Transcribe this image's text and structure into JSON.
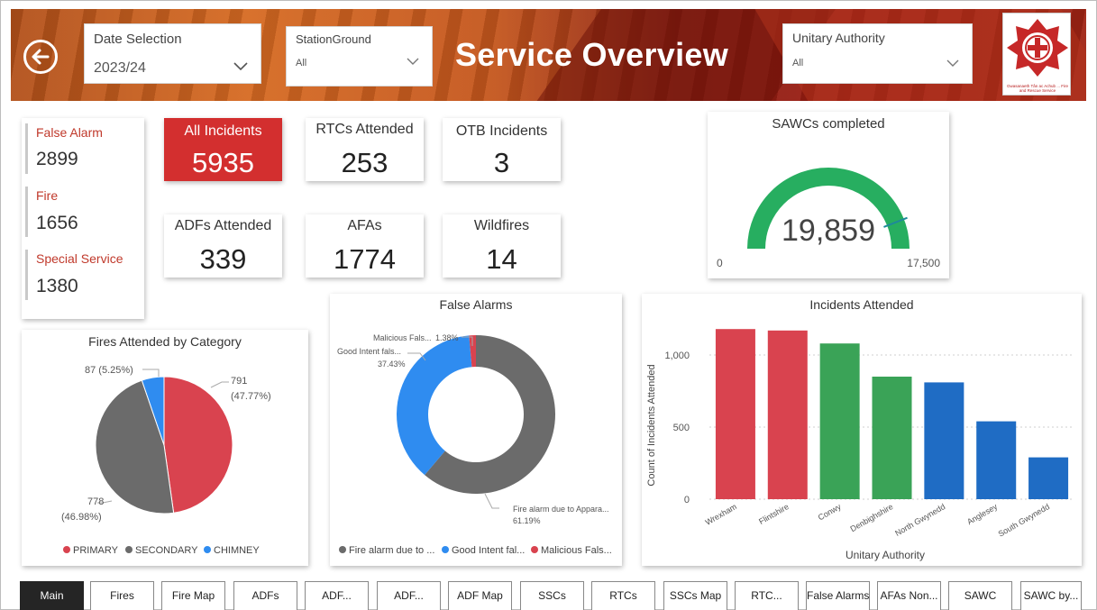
{
  "header": {
    "title": "Service Overview",
    "date_selection": {
      "label": "Date Selection",
      "value": "2023/24"
    },
    "station_ground": {
      "label": "StationGround",
      "value": "All"
    },
    "unitary_authority": {
      "label": "Unitary Authority",
      "value": "All"
    },
    "logo_caption": "Gwasanaeth Tân ac Achub ... Fire and Rescue Service"
  },
  "incident_types": {
    "false_alarm": {
      "label": "False Alarm",
      "value": "2899"
    },
    "fire": {
      "label": "Fire",
      "value": "1656"
    },
    "special_service": {
      "label": "Special Service",
      "value": "1380"
    }
  },
  "kpis": {
    "all_incidents": {
      "label": "All Incidents",
      "value": "5935"
    },
    "rtcs": {
      "label": "RTCs Attended",
      "value": "253"
    },
    "otb": {
      "label": "OTB Incidents",
      "value": "3"
    },
    "adfs": {
      "label": "ADFs Attended",
      "value": "339"
    },
    "afas": {
      "label": "AFAs",
      "value": "1774"
    },
    "wildfires": {
      "label": "Wildfires",
      "value": "14"
    }
  },
  "colors": {
    "accent_red": "#d32f2f",
    "gauge_green": "#27ae60",
    "gauge_teal": "#1e8a9a",
    "series_red": "#d9434f",
    "series_grey": "#6b6b6b",
    "series_blue": "#2f8cf0",
    "series_green": "#3aa357",
    "series_darkblue": "#1f6cc4"
  },
  "chart_data": [
    {
      "type": "gauge",
      "title": "SAWCs completed",
      "value": 19859,
      "value_label": "19,859",
      "min_label": "0",
      "target_label": "17,500",
      "min": 0,
      "target": 17500
    },
    {
      "type": "pie",
      "title": "Fires Attended by Category",
      "slices": [
        {
          "name": "PRIMARY",
          "value": 791,
          "label": "791",
          "pct": "(47.77%)"
        },
        {
          "name": "SECONDARY",
          "value": 778,
          "label": "778",
          "pct": "(46.98%)"
        },
        {
          "name": "CHIMNEY",
          "value": 87,
          "label": "87 (5.25%)",
          "pct": ""
        }
      ],
      "legend_placement": "bottom"
    },
    {
      "type": "pie",
      "title": "False Alarms",
      "slices": [
        {
          "name": "Fire alarm due to Appara...",
          "legend_name": "Fire alarm due to ...",
          "share": 61.19,
          "label": "Fire alarm due to Appara...",
          "pct": "61.19%"
        },
        {
          "name": "Good Intent fals...",
          "legend_name": "Good Intent fal...",
          "share": 37.43,
          "label": "Good Intent fals...",
          "pct": "37.43%"
        },
        {
          "name": "Malicious Fals...",
          "legend_name": "Malicious Fals...",
          "share": 1.38,
          "label": "Malicious Fals...",
          "pct": "1.38%"
        }
      ],
      "legend_placement": "bottom"
    },
    {
      "type": "bar",
      "title": "Incidents Attended",
      "categories": [
        "Wrexham",
        "Flintshire",
        "Conwy",
        "Denbighshire",
        "North Gwynedd",
        "Anglesey",
        "South Gwynedd"
      ],
      "values": [
        1180,
        1170,
        1080,
        850,
        810,
        540,
        290
      ],
      "xlabel": "Unitary Authority",
      "ylabel": "Count of Incidents Attended",
      "yticks": [
        "0",
        "500",
        "1,000"
      ],
      "ylim": [
        0,
        1300
      ],
      "grid": true
    }
  ],
  "tabs": [
    "Main",
    "Fires",
    "Fire Map",
    "ADFs",
    "ADF...",
    "ADF...",
    "ADF Map",
    "SSCs",
    "RTCs",
    "SSCs Map",
    "RTC...",
    "False Alarms",
    "AFAs Non...",
    "SAWC",
    "SAWC by..."
  ],
  "active_tab": "Main"
}
